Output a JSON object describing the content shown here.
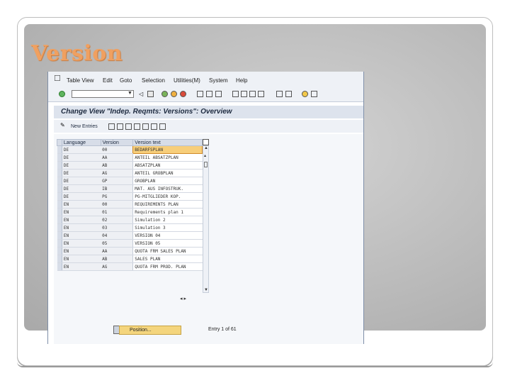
{
  "slide": {
    "title": "Version"
  },
  "menu": {
    "items": [
      "Table View",
      "Edit",
      "Goto",
      "Selection",
      "Utilities(M)",
      "System",
      "Help"
    ]
  },
  "screen": {
    "title": "Change View \"Indep. Reqmts: Versions\": Overview",
    "new_entries": "New Entries"
  },
  "table": {
    "columns": [
      "Language",
      "Version",
      "Version text"
    ],
    "rows": [
      [
        "DE",
        "00",
        "BEDARFSPLAN"
      ],
      [
        "DE",
        "AA",
        "ANTEIL ABSATZPLAN"
      ],
      [
        "DE",
        "AB",
        "ABSATZPLAN"
      ],
      [
        "DE",
        "AG",
        "ANTEIL GROBPLAN"
      ],
      [
        "DE",
        "GP",
        "GROBPLAN"
      ],
      [
        "DE",
        "IB",
        "MAT. AUS INFOSTRUK."
      ],
      [
        "DE",
        "PG",
        "PG-MITGLIEDER KOP."
      ],
      [
        "EN",
        "00",
        "REQUIREMENTS PLAN"
      ],
      [
        "EN",
        "01",
        "Requirements plan 1"
      ],
      [
        "EN",
        "02",
        "Simulation 2"
      ],
      [
        "EN",
        "03",
        "Simulation 3"
      ],
      [
        "EN",
        "04",
        "VERSION 04"
      ],
      [
        "EN",
        "05",
        "VERSION 05"
      ],
      [
        "EN",
        "AA",
        "QUOTA FRM SALES PLAN"
      ],
      [
        "EN",
        "AB",
        "SALES PLAN"
      ],
      [
        "EN",
        "AG",
        "QUOTA FRM PROD. PLAN"
      ]
    ]
  },
  "footer": {
    "position_label": "Position...",
    "entry_info": "Entry 1 of 61"
  }
}
